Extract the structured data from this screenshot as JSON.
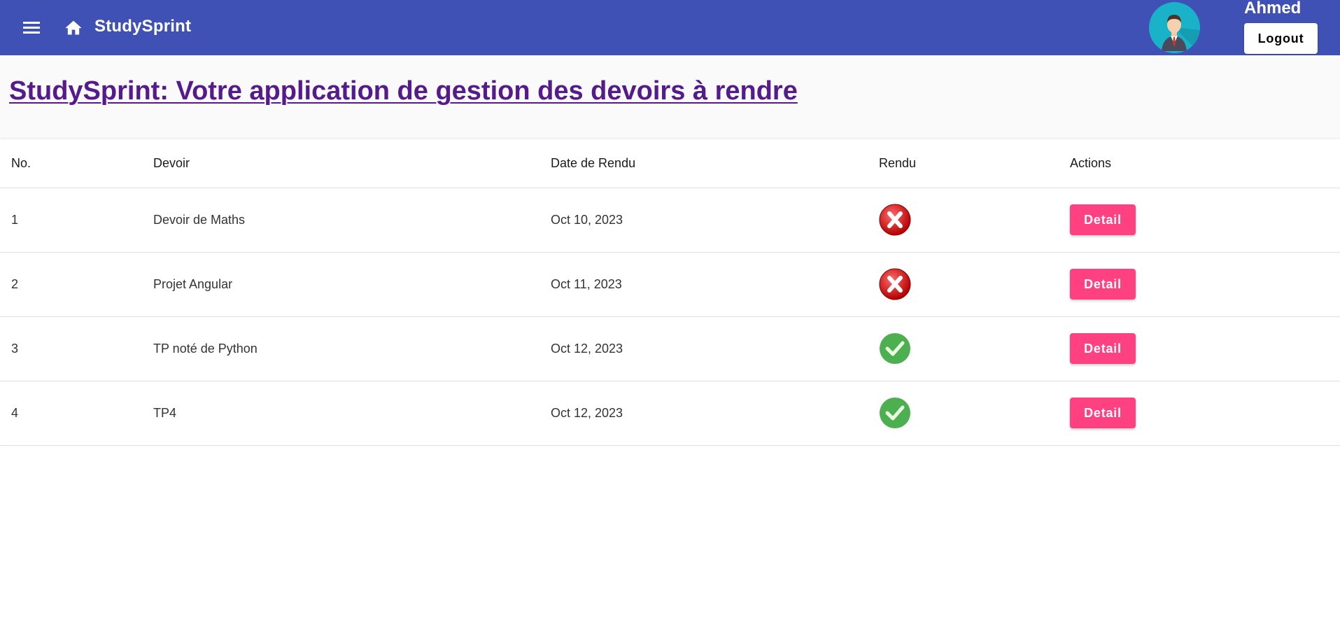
{
  "toolbar": {
    "menu_icon": "menu-icon",
    "home_icon": "home-icon",
    "app_title": "StudySprint",
    "user_name": "Ahmed",
    "logout_label": "Logout",
    "background_color": "#3f51b5"
  },
  "page": {
    "title": "StudySprint: Votre application de gestion des devoirs à rendre",
    "title_color": "#551a8b"
  },
  "table": {
    "headers": [
      "No.",
      "Devoir",
      "Date de Rendu",
      "Rendu",
      "Actions"
    ],
    "rows": [
      {
        "no": "1",
        "devoir": "Devoir de Maths",
        "date": "Oct 10, 2023",
        "rendu": false,
        "action": "Detail"
      },
      {
        "no": "2",
        "devoir": "Projet Angular",
        "date": "Oct 11, 2023",
        "rendu": false,
        "action": "Detail"
      },
      {
        "no": "3",
        "devoir": "TP noté de Python",
        "date": "Oct 12, 2023",
        "rendu": true,
        "action": "Detail"
      },
      {
        "no": "4",
        "devoir": "TP4",
        "date": "Oct 12, 2023",
        "rendu": true,
        "action": "Detail"
      }
    ]
  },
  "colors": {
    "accent": "#ff4081",
    "status_done": "#4caf50",
    "status_not_done": "#e01515"
  },
  "icons": {
    "done": "check-circle-icon",
    "not_done": "x-circle-icon"
  }
}
